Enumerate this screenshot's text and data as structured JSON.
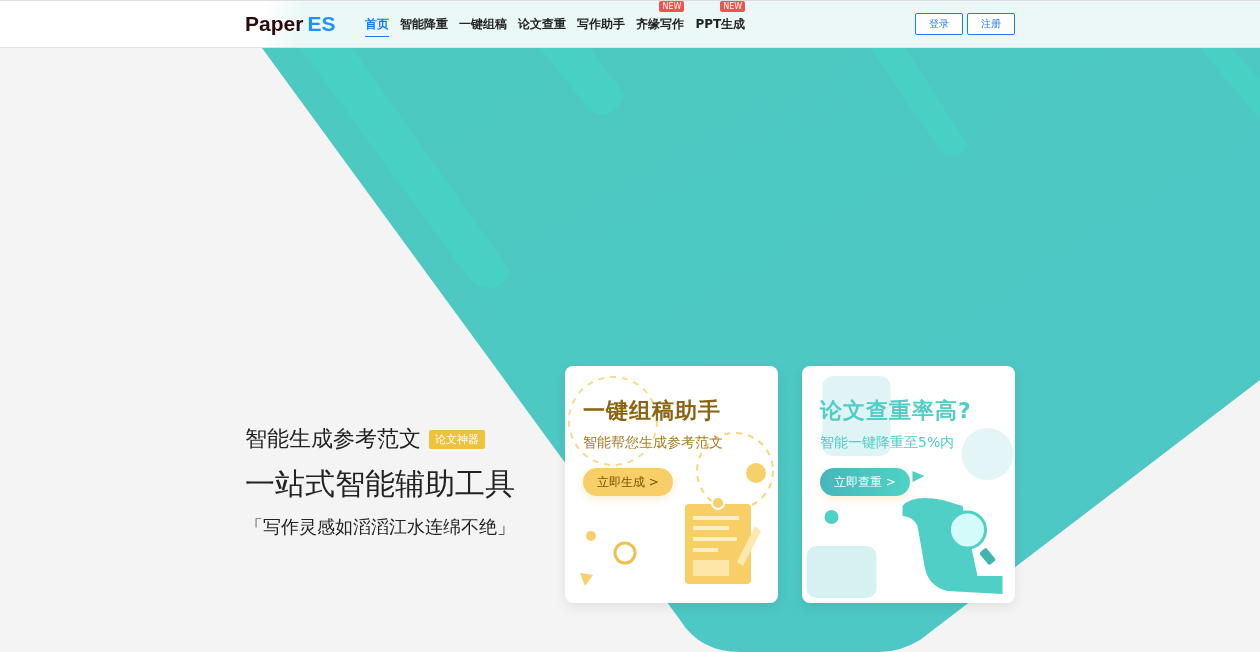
{
  "header": {
    "logo": {
      "word": "Paper",
      "accent": "ES"
    },
    "nav": [
      {
        "label": "首页",
        "selected": true
      },
      {
        "label": "智能降重",
        "selected": false
      },
      {
        "label": "一键组稿",
        "selected": false
      },
      {
        "label": "论文查重",
        "selected": false
      },
      {
        "label": "写作助手",
        "selected": false
      },
      {
        "label": "齐缘写作",
        "selected": false,
        "badge": "NEW"
      },
      {
        "label": "PPT生成",
        "selected": false,
        "badge": "NEW"
      }
    ],
    "buttons": [
      "登录",
      "注册"
    ]
  },
  "hero": {
    "subtitle": "智能生成参考范文",
    "tag": "论文神器",
    "title": "一站式智能辅助工具",
    "quote_open": "「",
    "quote": "写作灵感如滔滔江水连绵不绝",
    "quote_close": "」"
  },
  "cards": [
    {
      "kind": "compose",
      "title": "一键组稿助手",
      "text": "智能帮您生成参考范文",
      "button": "立即生成 >"
    },
    {
      "kind": "check",
      "title": "论文查重率高?",
      "text": "智能一键降重至5%内",
      "button": "立即查重 >"
    }
  ]
}
